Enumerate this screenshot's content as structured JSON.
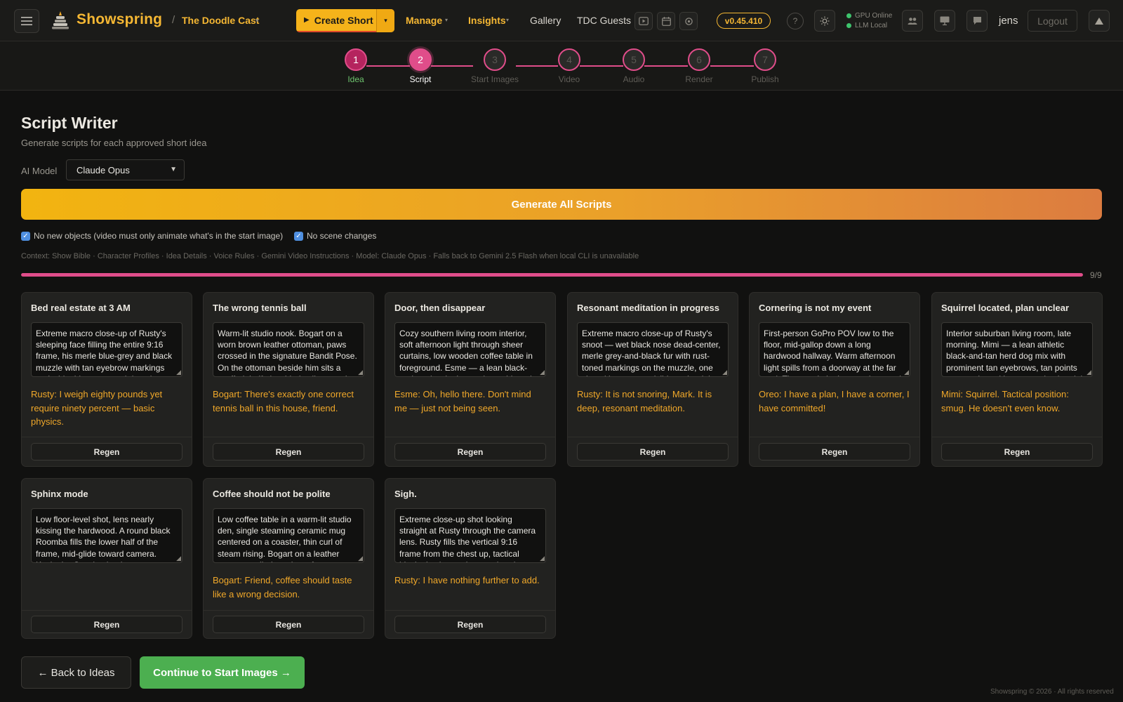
{
  "app": {
    "name": "Showspring",
    "show": "The Doodle Cast"
  },
  "nav": {
    "create_short": "Create Short",
    "manage": "Manage",
    "insights": "Insights",
    "gallery": "Gallery",
    "guests": "TDC Guests",
    "version": "v0.45.410",
    "help": "?",
    "gpu_status": "GPU Online",
    "llm_status": "LLM Local",
    "username": "jens",
    "logout": "Logout"
  },
  "steps": [
    {
      "num": "1",
      "label": "Idea",
      "state": "done"
    },
    {
      "num": "2",
      "label": "Script",
      "state": "active"
    },
    {
      "num": "3",
      "label": "Start Images",
      "state": "pending"
    },
    {
      "num": "4",
      "label": "Video",
      "state": "pending"
    },
    {
      "num": "5",
      "label": "Audio",
      "state": "pending"
    },
    {
      "num": "6",
      "label": "Render",
      "state": "pending"
    },
    {
      "num": "7",
      "label": "Publish",
      "state": "pending"
    }
  ],
  "header": {
    "title": "Script Writer",
    "subtitle": "Generate scripts for each approved short idea",
    "model_label": "AI Model",
    "model_value": "Claude Opus"
  },
  "generate_all": "Generate All Scripts",
  "options": {
    "no_new_objects": "No new objects (video must only animate what's in the start image)",
    "no_new_objects_checked": true,
    "no_scene_changes": "No scene changes",
    "no_scene_changes_checked": true
  },
  "context_line": "Context: Show Bible · Character Profiles · Idea Details · Voice Rules · Gemini Video Instructions · Model: Claude Opus · Falls back to Gemini 2.5 Flash when local CLI is unavailable",
  "progress": {
    "text": "9/9",
    "fraction": 1.0
  },
  "regen_label": "Regen",
  "cards": [
    {
      "title": "Bed real estate at 3 AM",
      "prompt": "Extreme macro close-up of Rusty's sleeping face filling the entire 9:16 frame, his merle blue-grey and black muzzle with tan eyebrow markings and white blaze pressed deep into a",
      "dialogue": "Rusty: I weigh eighty pounds yet require ninety percent — basic physics."
    },
    {
      "title": "The wrong tennis ball",
      "prompt": "Warm-lit studio nook. Bogart on a worn brown leather ottoman, paws crossed in the signature Bandit Pose. On the ottoman beside him sits a scuffed, half-shredded yellow tennis",
      "dialogue": "Bogart: There's exactly one correct tennis ball in this house, friend."
    },
    {
      "title": "Door, then disappear",
      "prompt": "Cozy southern living room interior, soft afternoon light through sheer curtains, low wooden coffee table in foreground. Esme — a lean black-and-tan herd mix wearing a thin red",
      "dialogue": "Esme: Oh, hello there. Don't mind me — just not being seen."
    },
    {
      "title": "Resonant meditation in progress",
      "prompt": "Extreme macro close-up of Rusty's snoot — wet black nose dead-center, merle grey-and-black fur with rust-toned markings on the muzzle, one closed brown eye visible at the right",
      "dialogue": "Rusty: It is not snoring, Mark. It is deep, resonant meditation."
    },
    {
      "title": "Cornering is not my event",
      "prompt": "First-person GoPro POV low to the floor, mid-gallop down a long hardwood hallway. Warm afternoon light spills from a doorway at the far end. The wood planks stretch toward",
      "dialogue": "Oreo: I have a plan, I have a corner, I have committed!"
    },
    {
      "title": "Squirrel located, plan unclear",
      "prompt": "Interior suburban living room, late morning. Mimi — a lean athletic black-and-tan herd dog mix with prominent tan eyebrows, tan points on muzzle and legs, oversized upright",
      "dialogue": "Mimi: Squirrel. Tactical position: smug. He doesn't even know."
    },
    {
      "title": "Sphinx mode",
      "prompt": "Low floor-level shot, lens nearly kissing the hardwood. A round black Roomba fills the lower half of the frame, mid-glide toward camera. Kevin the Cat sits dead-center on top",
      "dialogue": ""
    },
    {
      "title": "Coffee should not be polite",
      "prompt": "Low coffee table in a warm-lit studio den, single steaming ceramic mug centered on a coaster, thin curl of steam rising. Bogart on a leather ottoman pulled up close, front paws",
      "dialogue": "Bogart: Friend, coffee should taste like a wrong decision."
    },
    {
      "title": "Sigh.",
      "prompt": "Extreme close-up shot looking straight at Rusty through the camera lens. Rusty fills the vertical 9:16 frame from the chest up, tactical black plastic sunglasses already seated on",
      "dialogue": "Rusty: I have nothing further to add."
    }
  ],
  "footer_nav": {
    "back": "← Back to Ideas",
    "continue": "Continue to Start Images →"
  },
  "copyright": "Showspring © 2026 · All rights reserved",
  "colors": {
    "accent_gold": "#f5b733",
    "accent_pink": "#e04d8a",
    "success_green": "#4caf50",
    "dialogue_orange": "#f0a82a"
  }
}
